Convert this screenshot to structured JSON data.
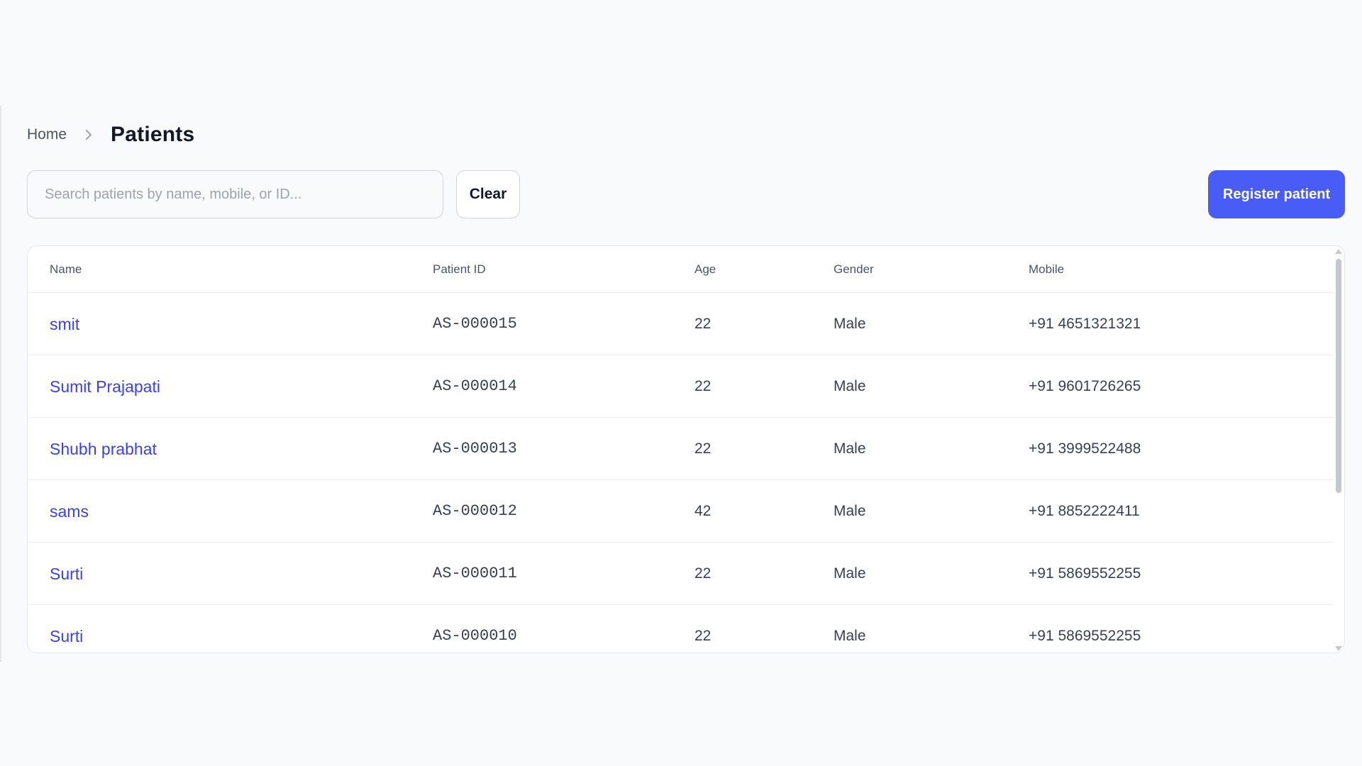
{
  "breadcrumb": {
    "home": "Home",
    "current": "Patients"
  },
  "search": {
    "placeholder": "Search patients by name, mobile, or ID...",
    "value": ""
  },
  "toolbar": {
    "clear_label": "Clear",
    "register_label": "Register patient"
  },
  "table": {
    "columns": [
      "Name",
      "Patient ID",
      "Age",
      "Gender",
      "Mobile"
    ],
    "rows": [
      {
        "name": "smit",
        "patient_id": "AS-000015",
        "age": "22",
        "gender": "Male",
        "mobile": "+91 4651321321"
      },
      {
        "name": "Sumit Prajapati",
        "patient_id": "AS-000014",
        "age": "22",
        "gender": "Male",
        "mobile": "+91 9601726265"
      },
      {
        "name": "Shubh prabhat",
        "patient_id": "AS-000013",
        "age": "22",
        "gender": "Male",
        "mobile": "+91 3999522488"
      },
      {
        "name": "sams",
        "patient_id": "AS-000012",
        "age": "42",
        "gender": "Male",
        "mobile": "+91 8852222411"
      },
      {
        "name": "Surti",
        "patient_id": "AS-000011",
        "age": "22",
        "gender": "Male",
        "mobile": "+91 5869552255"
      },
      {
        "name": "Surti",
        "patient_id": "AS-000010",
        "age": "22",
        "gender": "Male",
        "mobile": "+91 5869552255"
      }
    ]
  },
  "colors": {
    "accent": "#4a5cf6",
    "link": "#3b3ff0",
    "background": "#f9fafb"
  },
  "icons": {
    "breadcrumb_separator": "chevron-right-icon"
  }
}
